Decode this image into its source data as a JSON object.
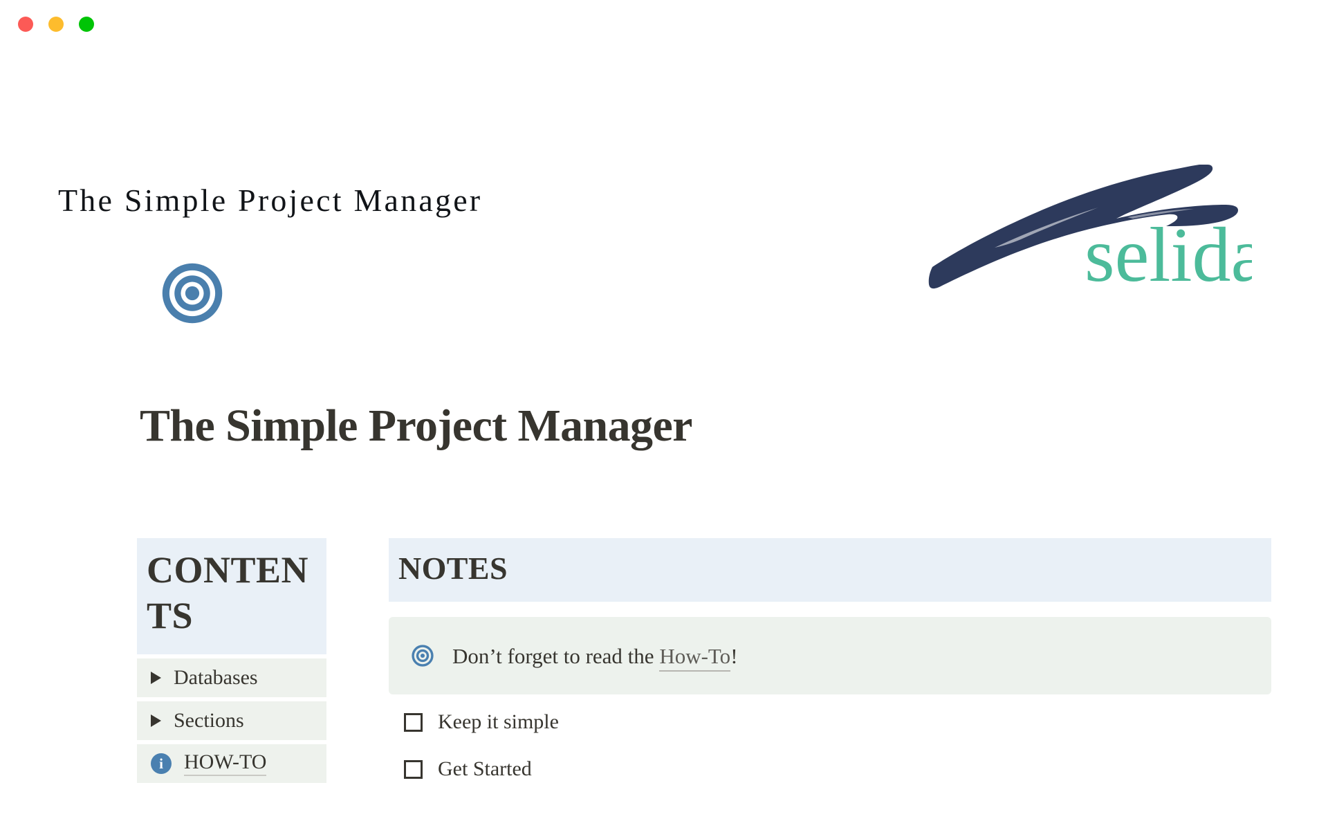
{
  "window": {
    "controls": [
      {
        "name": "close",
        "color": "#fc5a56"
      },
      {
        "name": "minimize",
        "color": "#fdbc2d"
      },
      {
        "name": "maximize",
        "color": "#00c406"
      }
    ]
  },
  "cover": {
    "title": "The Simple Project Manager",
    "art_style": "blue watercolor brushstrokes",
    "art_color": "#a5cfdf"
  },
  "brand": {
    "name": "selida",
    "mark_color": "#2d3a5c",
    "text_color": "#4cbb9a"
  },
  "page": {
    "icon": "bullseye-target-icon",
    "icon_color": "#4a7fad",
    "title": "The Simple Project Manager"
  },
  "contents": {
    "heading": "CONTENTS",
    "heading_bg": "#e9f0f7",
    "items": [
      {
        "label": "Databases",
        "icon": "toggle-triangle-icon",
        "linked": false
      },
      {
        "label": "Sections",
        "icon": "toggle-triangle-icon",
        "linked": false
      },
      {
        "label": "HOW-TO",
        "icon": "info-icon",
        "linked": true
      }
    ]
  },
  "notes": {
    "heading": "NOTES",
    "heading_bg": "#e9f0f7",
    "callout": {
      "icon": "bullseye-target-icon",
      "text_before": "Don’t forget to read the ",
      "link_text": "How-To",
      "text_after": "!",
      "bg": "#edf2ed"
    },
    "todos": [
      {
        "label": "Keep it simple",
        "checked": false
      },
      {
        "label": "Get Started",
        "checked": false
      }
    ]
  }
}
